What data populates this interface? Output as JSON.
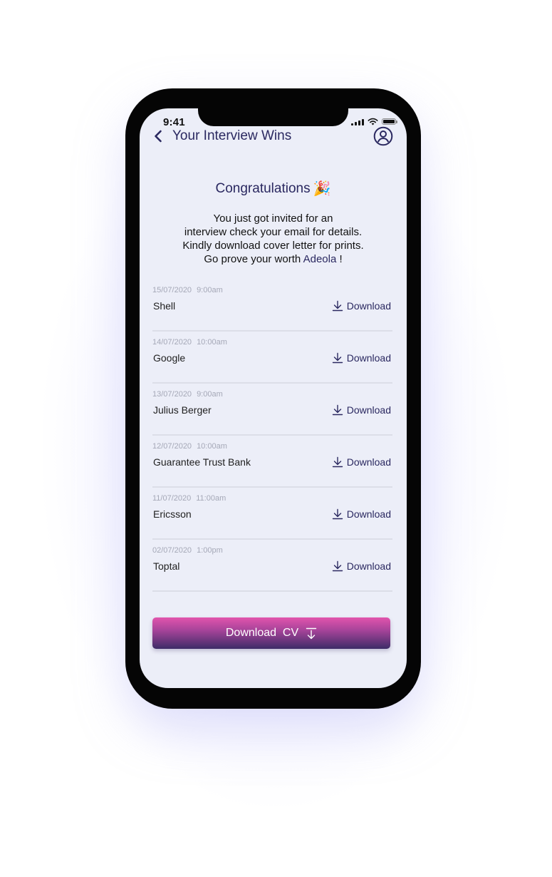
{
  "status_bar": {
    "time": "9:41"
  },
  "header": {
    "title": "Your Interview Wins",
    "back_icon": "chevron-left-icon",
    "profile_icon": "user-circle-icon"
  },
  "congrats": {
    "title": "Congratulations",
    "emoji": "🎉",
    "message_lines": [
      "You just got invited for an",
      "interview check your email for details.",
      "Kindly download cover letter for prints.",
      "Go prove your worth"
    ],
    "name": "Adeola",
    "name_suffix": "!"
  },
  "interviews": [
    {
      "date": "15/07/2020",
      "time": "9:00am",
      "company": "Shell",
      "action": "Download"
    },
    {
      "date": "14/07/2020",
      "time": "10:00am",
      "company": "Google",
      "action": "Download"
    },
    {
      "date": "13/07/2020",
      "time": "9:00am",
      "company": "Julius Berger",
      "action": "Download"
    },
    {
      "date": "12/07/2020",
      "time": "10:00am",
      "company": "Guarantee Trust Bank",
      "action": "Download"
    },
    {
      "date": "11/07/2020",
      "time": "11:00am",
      "company": "Ericsson",
      "action": "Download"
    },
    {
      "date": "02/07/2020",
      "time": "1:00pm",
      "company": "Toptal",
      "action": "Download"
    }
  ],
  "download_cv": {
    "label": "Download  CV"
  },
  "colors": {
    "primary": "#2a2860",
    "screen_bg": "#eceef8",
    "gradient_top": "#e254ad",
    "gradient_bottom": "#3d2c67",
    "muted_text": "#a5a8b7"
  }
}
